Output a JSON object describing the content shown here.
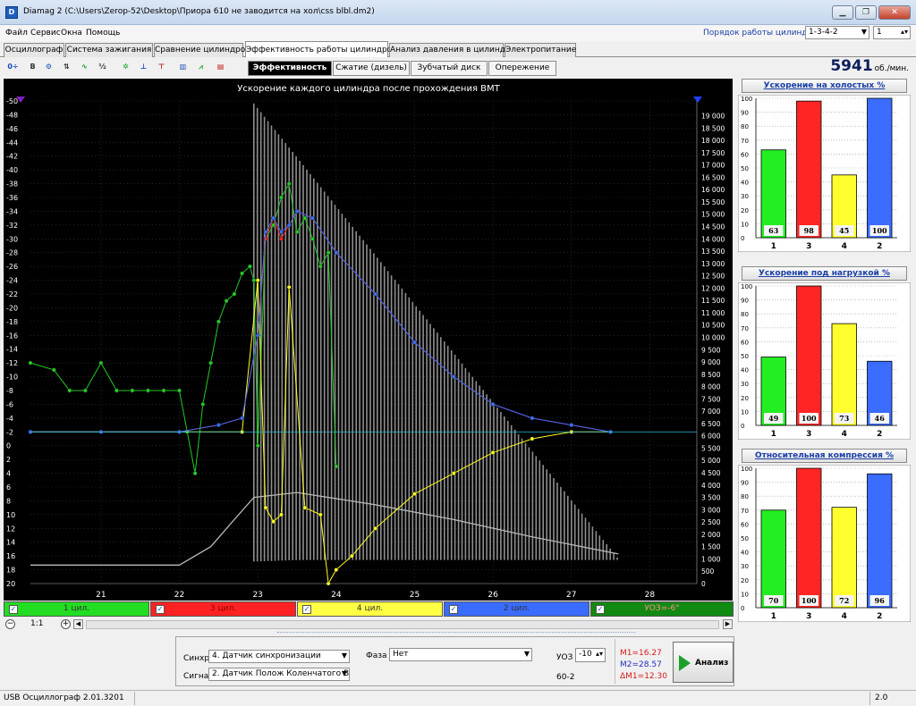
{
  "window": {
    "title": "Diamag 2 (C:\\Users\\Zerop-52\\Desktop\\Приора 610 не заводится на хол\\css blbl.dm2)",
    "app_icon": "D"
  },
  "menu": [
    "Файл",
    "Сервис",
    "Окна",
    "Помощь"
  ],
  "firing_order": {
    "label": "Порядок работы цилиндров",
    "value": "1-3-4-2",
    "spinner": "1"
  },
  "main_tabs": [
    "Осциллограф",
    "Система зажигания",
    "Сравнение цилиндров",
    "Эффективность работы цилиндров",
    "Анализ давления в цилиндре",
    "Электропитание"
  ],
  "active_main_tab": 3,
  "sub_tabs": [
    "Эффективность",
    "Сжатие (дизель)",
    "Зубчатый диск",
    "Опережение"
  ],
  "rpm": {
    "value": "5941",
    "unit": "об./мин."
  },
  "chart_data": {
    "type": "line",
    "title": "Ускорение каждого цилиндра после прохождения ВМТ",
    "x_ticks": [
      "21",
      "22",
      "23",
      "24",
      "25",
      "26",
      "27",
      "28"
    ],
    "xlim": [
      20.1,
      28.6
    ],
    "y_left_ticks": [
      "-50",
      "-48",
      "-46",
      "-44",
      "-42",
      "-40",
      "-38",
      "-36",
      "-34",
      "-32",
      "-30",
      "-28",
      "-26",
      "-24",
      "-22",
      "-20",
      "-18",
      "-16",
      "-14",
      "-12",
      "-10",
      "-8",
      "-6",
      "-4",
      "-2",
      "0",
      "2",
      "4",
      "6",
      "8",
      "10",
      "12",
      "14",
      "16",
      "18",
      "20"
    ],
    "ylim_left": [
      -50,
      20
    ],
    "y_right_ticks": [
      "19 000",
      "18 500",
      "18 000",
      "17 500",
      "17 000",
      "16 500",
      "16 000",
      "15 500",
      "15 000",
      "14 500",
      "14 000",
      "13 500",
      "13 000",
      "12 500",
      "12 000",
      "11 500",
      "11 000",
      "10 500",
      "10 000",
      "9 500",
      "9 000",
      "8 500",
      "8 000",
      "7 500",
      "7 000",
      "6 500",
      "6 000",
      "5 500",
      "5 000",
      "4 500",
      "4 000",
      "3 500",
      "3 000",
      "2 500",
      "2 000",
      "1 500",
      "1 000",
      "500",
      "0"
    ],
    "ylim_right": [
      0,
      19600
    ],
    "grid": true,
    "series": [
      {
        "name": "1 цил.",
        "color": "#22cc22",
        "x": [
          20.1,
          20.4,
          20.6,
          20.8,
          21.0,
          21.2,
          21.4,
          21.6,
          21.8,
          22.0,
          22.1,
          22.2,
          22.3,
          22.4,
          22.5,
          22.6,
          22.7,
          22.8,
          22.9,
          22.95,
          23.0,
          23.1,
          23.2,
          23.3,
          23.4,
          23.5,
          23.6,
          23.7,
          23.8,
          23.9,
          24.0
        ],
        "y": [
          -12,
          -11,
          -8,
          -8,
          -12,
          -8,
          -8,
          -8,
          -8,
          -8,
          -2,
          4,
          -6,
          -12,
          -18,
          -21,
          -22,
          -25,
          -26,
          -24,
          0,
          -30,
          -32,
          -36,
          -38,
          -31,
          -33,
          -30,
          -26,
          -28,
          3
        ]
      },
      {
        "name": "3 цил.",
        "color": "#ff2020",
        "x": [
          20.1,
          21.0,
          22.0,
          22.5,
          22.8,
          23.0,
          23.1,
          23.2,
          23.3,
          23.4,
          23.5,
          23.7,
          24.0,
          24.5,
          25.0,
          25.5,
          26.0,
          26.5,
          27.0,
          27.5
        ],
        "y": [
          -2,
          -2,
          -2,
          -3,
          -4,
          -16,
          -30,
          -33,
          -30,
          -32,
          -34,
          -33,
          -28,
          -22,
          -15,
          -10,
          -6,
          -4,
          -3,
          -2
        ]
      },
      {
        "name": "4 цил.",
        "color": "#ffff20",
        "x": [
          20.1,
          21.0,
          22.0,
          22.8,
          23.0,
          23.1,
          23.2,
          23.3,
          23.4,
          23.6,
          23.8,
          23.9,
          24.0,
          24.2,
          24.5,
          25.0,
          25.5,
          26.0,
          26.5,
          27.0,
          27.5
        ],
        "y": [
          -2,
          -2,
          -2,
          -2,
          -24,
          9,
          11,
          10,
          -23,
          9,
          10,
          20,
          18,
          16,
          12,
          7,
          4,
          1,
          -1,
          -2,
          -2
        ]
      },
      {
        "name": "2 цил.",
        "color": "#3a6cff",
        "x": [
          20.1,
          21.0,
          22.0,
          22.5,
          22.8,
          23.0,
          23.1,
          23.2,
          23.3,
          23.4,
          23.5,
          23.7,
          24.0,
          24.5,
          25.0,
          25.5,
          26.0,
          26.5,
          27.0,
          27.5
        ],
        "y": [
          -2,
          -2,
          -2,
          -3,
          -4,
          -16,
          -31,
          -33,
          -31,
          -32,
          -34,
          -33,
          -28,
          -22,
          -15,
          -10,
          -6,
          -4,
          -3,
          -2
        ]
      }
    ]
  },
  "cylinders": [
    {
      "label": "1 цил.",
      "color": "#22dd22"
    },
    {
      "label": "3 цил.",
      "color": "#ff2222"
    },
    {
      "label": "4 цил.",
      "color": "#ffff44"
    },
    {
      "label": "2 цил.",
      "color": "#3a6cff"
    },
    {
      "label": "УОЗ=-6°",
      "color": "#108a10"
    }
  ],
  "zoom": "1:1",
  "panels": [
    {
      "title": "Ускорение на холостых %",
      "labels": [
        "1",
        "3",
        "4",
        "2"
      ],
      "values": [
        63,
        98,
        45,
        100
      ]
    },
    {
      "title": "Ускорение под нагрузкой %",
      "labels": [
        "1",
        "3",
        "4",
        "2"
      ],
      "values": [
        49,
        100,
        73,
        46
      ]
    },
    {
      "title": "Относительная компрессия %",
      "labels": [
        "1",
        "3",
        "4",
        "2"
      ],
      "values": [
        70,
        100,
        72,
        96
      ]
    }
  ],
  "panel_y_ticks": [
    "0",
    "10",
    "20",
    "30",
    "40",
    "50",
    "60",
    "70",
    "80",
    "90",
    "100"
  ],
  "bar_colors": [
    "#22ee22",
    "#ff2525",
    "#ffff30",
    "#3a6cff"
  ],
  "controls": {
    "sync_label": "Синхро:",
    "sync_value": "4. Датчик синхронизации",
    "signal_label": "Сигнал:",
    "signal_value": "2. Датчик Полож Коленчатого Вал",
    "phase_label": "Фаза",
    "phase_value": "Нет",
    "uoz_label": "УОЗ",
    "uoz_value": "-10",
    "wheel": "60-2",
    "m1": "M1=16.27",
    "m2": "M2=28.57",
    "dm": "ΔM1=12.30",
    "analyze": "Анализ"
  },
  "status": {
    "left": "USB Осциллограф  2.01.3201",
    "right": "2.0"
  }
}
